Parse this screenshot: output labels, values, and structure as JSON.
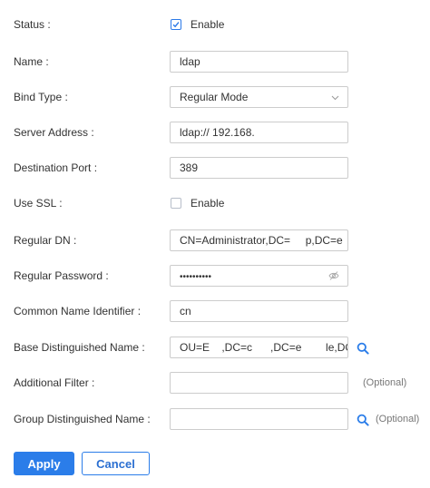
{
  "form": {
    "status": {
      "label": "Status",
      "checked": true,
      "option_label": "Enable"
    },
    "name": {
      "label": "Name",
      "value": "ldap"
    },
    "bind_type": {
      "label": "Bind Type",
      "value": "Regular Mode"
    },
    "server_address": {
      "label": "Server Address",
      "value": "ldap:// 192.168."
    },
    "destination_port": {
      "label": "Destination Port",
      "value": "389"
    },
    "use_ssl": {
      "label": "Use SSL",
      "checked": false,
      "option_label": "Enable"
    },
    "regular_dn": {
      "label": "Regular DN",
      "value": "CN=Administrator,DC=     p,DC=e"
    },
    "regular_password": {
      "label": "Regular Password",
      "value": "••••••••••"
    },
    "common_name_identifier": {
      "label": "Common Name Identifier",
      "value": "cn"
    },
    "base_dn": {
      "label": "Base Distinguished Name",
      "value": "OU=E    ,DC=c      ,DC=e        le,DC"
    },
    "additional_filter": {
      "label": "Additional Filter",
      "value": "",
      "hint": "(Optional)"
    },
    "group_dn": {
      "label": "Group Distinguished Name",
      "value": "",
      "hint": "(Optional)"
    }
  },
  "buttons": {
    "apply": "Apply",
    "cancel": "Cancel"
  },
  "colors": {
    "accent": "#2b7de9",
    "border": "#cccccc",
    "text": "#333333"
  },
  "icons": {
    "search": "search-icon",
    "chevron": "chevron-down-icon",
    "eye": "eye-off-icon",
    "check": "check-icon"
  }
}
